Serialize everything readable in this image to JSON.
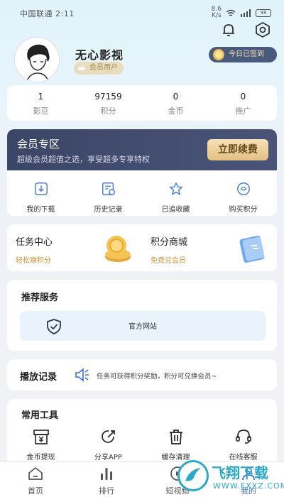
{
  "status_bar": {
    "carrier_time": "中国联通 2:11",
    "speed_value": "8.6",
    "speed_unit": "K/s",
    "battery": "98"
  },
  "profile": {
    "username": "无心影视",
    "member_badge": "会员用户",
    "signin_label": "今日已签到"
  },
  "stats": [
    {
      "value": "1",
      "label": "影豆"
    },
    {
      "value": "97159",
      "label": "积分"
    },
    {
      "value": "0",
      "label": "金币"
    },
    {
      "value": "0",
      "label": "推广"
    }
  ],
  "vip": {
    "title": "会员专区",
    "description": "超级会员超值之选，享受超多专享特权",
    "renew_button": "立即续费"
  },
  "quick_actions": [
    {
      "label": "我的下载",
      "icon": "download-icon"
    },
    {
      "label": "历史记录",
      "icon": "history-icon"
    },
    {
      "label": "已追收藏",
      "icon": "star-icon"
    },
    {
      "label": "购买积分",
      "icon": "points-icon"
    }
  ],
  "tasks": [
    {
      "title": "任务中心",
      "subtitle": "轻松赚积分",
      "icon": "coin-stack-icon"
    },
    {
      "title": "积分商城",
      "subtitle": "免费兑会员",
      "icon": "card-icon"
    }
  ],
  "services": {
    "heading": "推荐服务",
    "official_site": "官方网站"
  },
  "history": {
    "heading": "播放记录",
    "marquee": "任务可获得积分奖励，积分可兑换会员~"
  },
  "tools": {
    "heading": "常用工具",
    "items": [
      {
        "label": "金币提现",
        "icon": "wallet-icon"
      },
      {
        "label": "分享APP",
        "icon": "share-icon"
      },
      {
        "label": "缓存清理",
        "icon": "trash-icon"
      },
      {
        "label": "在线客服",
        "icon": "headset-icon"
      }
    ]
  },
  "tabbar": [
    {
      "label": "首页",
      "icon": "home-icon"
    },
    {
      "label": "排行",
      "icon": "chart-icon"
    },
    {
      "label": "短视频",
      "icon": "video-icon"
    },
    {
      "label": "我的",
      "icon": "user-icon"
    }
  ],
  "watermark": {
    "brand": "飞翔下载",
    "domain": "WWW.FXXZ.COM"
  },
  "colors": {
    "accent": "#3d6fd6",
    "vip_bg": "#3b4566",
    "gold": "#e2c084",
    "task_subtitle": "#d0963b"
  }
}
